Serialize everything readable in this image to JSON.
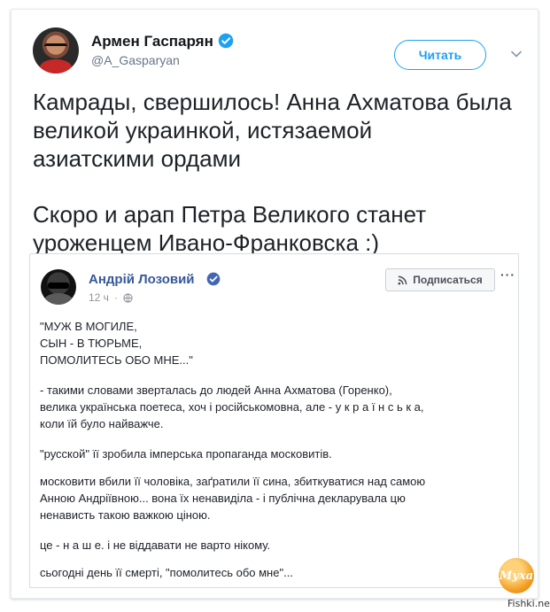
{
  "tweet": {
    "author_name": "Армен Гаспарян",
    "author_handle": "@A_Gasparyan",
    "follow_label": "Читать",
    "text_lines": [
      "Камрады, свершилось! Анна Ахматова была",
      "великой украинкой, истязаемой",
      "азиатскими ордами"
    ],
    "text_lines_2": [
      "Скоро и арап Петра Великого станет",
      "уроженцем Ивано-Франковска :)"
    ]
  },
  "fb_post": {
    "author_name": "Андрій Лозовий",
    "time": "12 ч",
    "time_separator": "·",
    "subscribe_label": "Подписаться",
    "menu_label": "···",
    "paragraphs": [
      [
        "\"МУЖ В МОГИЛЕ,",
        "СЫН - В ТЮРЬМЕ,",
        "ПОМОЛИТЕСЬ ОБО МНЕ...\""
      ],
      [
        "- такими словами зверталась до людей Анна Ахматова (Горенко),",
        "велика українська поетеса, хоч і російськомовна, але - у к р а ї н с ь к а,",
        "коли їй було найважче."
      ],
      [
        "\"русской\" її зробила імперська пропаганда московитів."
      ],
      [
        "московити вбили її чоловіка, заґратили її сина, збиткуватися над самою",
        "Анною Андріївною... вона їх ненавиділа - і публічна декларувала цю",
        "ненависть такою важкою ціною."
      ],
      [
        "це - н а ш е. і не віддавати не варто нікому."
      ],
      [
        "сьогодні день її смерті, \"помолитесь обо мне\"..."
      ]
    ]
  },
  "watermark": {
    "logo_text": "Муха",
    "site": "Fishki.net"
  },
  "icons": {
    "tweet_verified": "verified-badge-icon",
    "tweet_menu": "chevron-down-icon",
    "fb_verified": "verified-badge-icon",
    "fb_globe": "globe-icon",
    "fb_subscribe": "rss-icon"
  },
  "colors": {
    "twitter_blue": "#1da1f2",
    "fb_name_blue": "#365899",
    "watermark_orange": "#f29c1f"
  }
}
